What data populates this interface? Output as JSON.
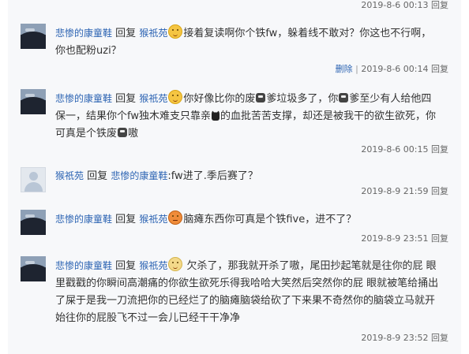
{
  "reply_label": "回复",
  "comments": [
    {
      "timestamp": "2019-8-6 00:13",
      "reply": "回复"
    },
    {
      "author": "悲惨的康童鞋",
      "verb": "回复",
      "target": "猴祇苑",
      "text_1": "接着复读啊你个铁fw，躲着线不敢对？你这也不行啊，你也配粉uzi？",
      "emoji": "smirk-emoji",
      "delete": "删除",
      "separator": "|",
      "timestamp": "2019-8-6 00:14",
      "reply": "回复"
    },
    {
      "author": "悲惨的康童鞋",
      "verb": "回复",
      "target": "猴祇苑",
      "text_1": "你好像比你的废",
      "text_2": "爹垃圾多了，你",
      "text_3": "爹至少有人给他四保一，结果你个fw独木难支只靠亲",
      "text_4": "的血批苦苦支撑，却还是被我干的欲生欲死，你可真是个铁废",
      "text_5": "嗷",
      "emoji": "smirk-emoji",
      "timestamp": "2019-8-6 00:15",
      "reply": "回复"
    },
    {
      "author": "猴祇苑",
      "verb": "回复",
      "target": "悲惨的康童鞋",
      "text_1": ":fw进了.季后赛了？",
      "timestamp": "2019-8-9 21:59",
      "reply": "回复"
    },
    {
      "author": "悲惨的康童鞋",
      "verb": "回复",
      "target": "猴祇苑",
      "text_1": "脑瘫东西你可真是个铁five，进不了？",
      "emoji": "angry-emoji",
      "timestamp": "2019-8-9 23:51",
      "reply": "回复"
    },
    {
      "author": "悲惨的康童鞋",
      "verb": "回复",
      "target": "猴祇苑",
      "text_1": "欠杀了，那我就开杀了嗷，尾田抄起笔就是往你的屁 眼里戳戳的你瞬间高潮痛的你欲生欲死乐得我哈哈大笑然后突然你的屁 眼就被笔给捅出了屎于是我一刀流把你的已经烂了的脑瘫脑袋给砍了下来果不奇然你的脑袋立马就开始往你的屁股飞不过一会儿已经干干净净",
      "emoji": "pale-emoji",
      "timestamp": "2019-8-9 23:52",
      "reply": "回复"
    }
  ]
}
